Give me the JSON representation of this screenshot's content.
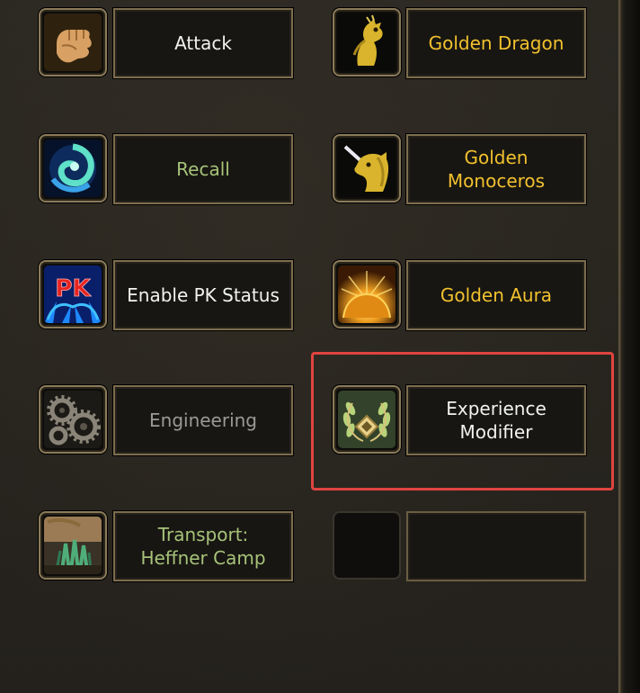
{
  "skills": [
    {
      "label": "Attack",
      "icon": "fist-icon",
      "color": "#f2f2f0"
    },
    {
      "label": "Golden Dragon",
      "icon": "golden-dragon-icon",
      "color": "#f2c12e"
    },
    {
      "label": "Recall",
      "icon": "recall-swirl-icon",
      "color": "#a7c27a"
    },
    {
      "label": "Golden Monoceros",
      "icon": "golden-unicorn-icon",
      "color": "#f2c12e"
    },
    {
      "label": "Enable PK Status",
      "icon": "pk-icon",
      "icon_text": "PK",
      "color": "#f2f2f0"
    },
    {
      "label": "Golden Aura",
      "icon": "sunrise-icon",
      "color": "#f2c12e"
    },
    {
      "label": "Engineering",
      "icon": "gears-icon",
      "color": "#9a9a96"
    },
    {
      "label_line1": "Experience",
      "label_line2": "Modifier",
      "icon": "laurel-wreath-icon",
      "color": "#f2f2f0",
      "highlighted": true
    },
    {
      "label_line1": "Transport:",
      "label_line2": "Heffner Camp",
      "icon": "camp-icon",
      "color": "#a7c27a"
    },
    {
      "label": "",
      "icon": "empty-slot",
      "empty": true
    }
  ],
  "highlight_color": "#e0443f"
}
